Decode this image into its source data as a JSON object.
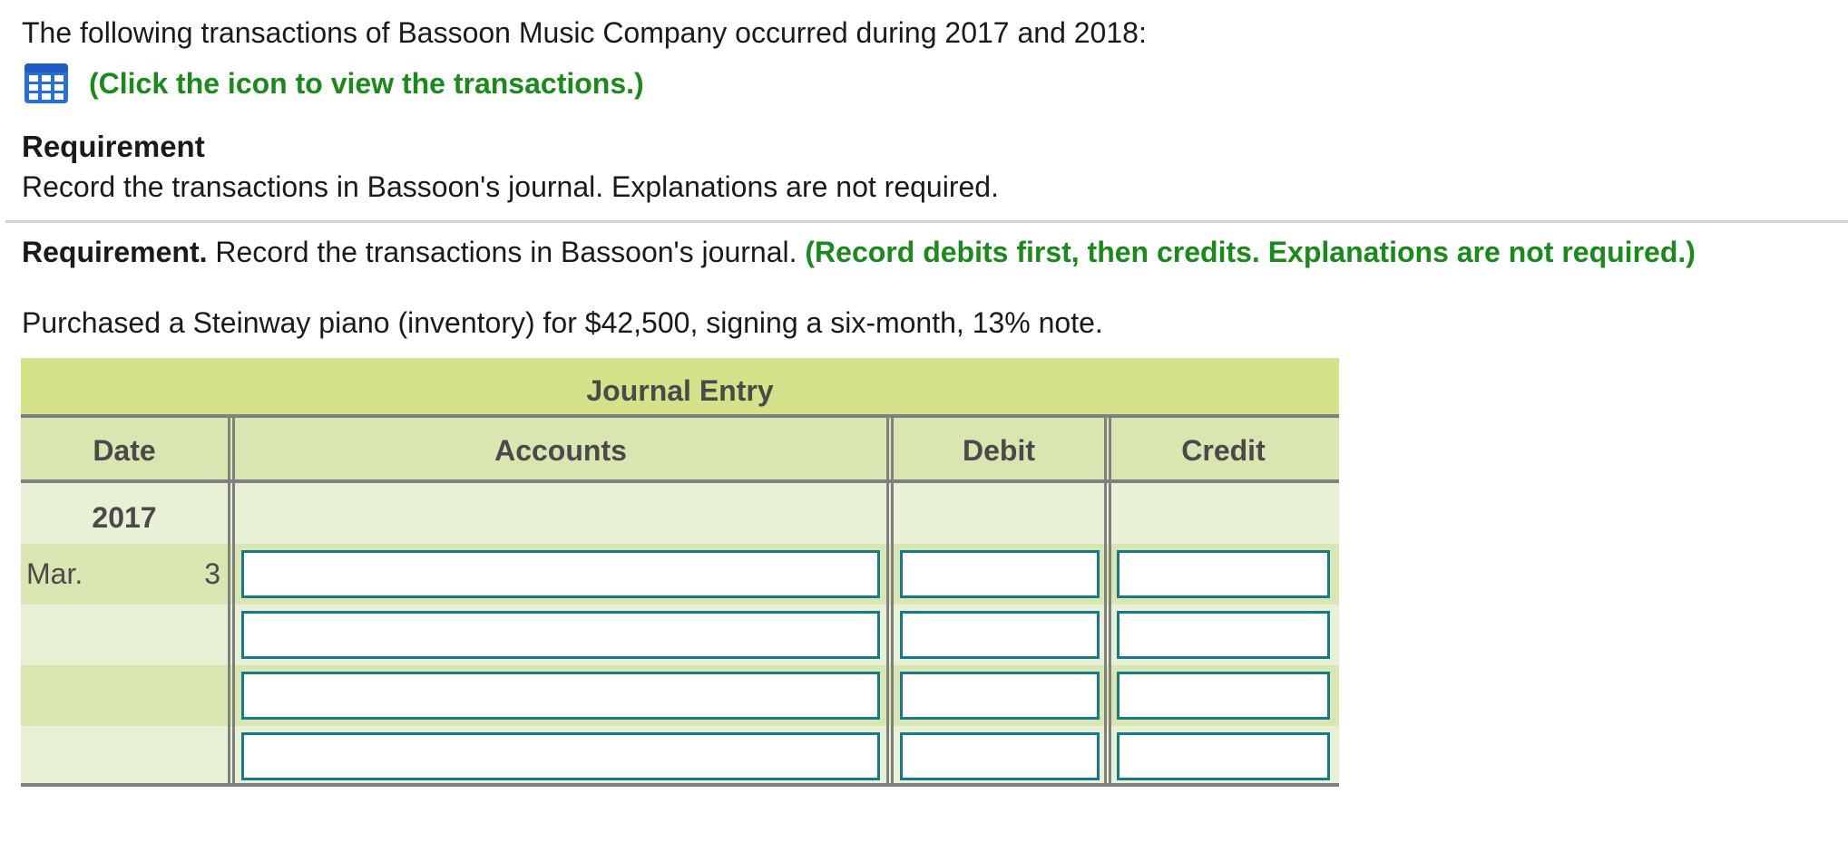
{
  "intro": {
    "text": "The following transactions of Bassoon Music Company occurred during 2017 and 2018:"
  },
  "transactions_link": {
    "icon": "table-icon",
    "label": "(Click the icon to view the transactions.)",
    "color": "#1a8a1a"
  },
  "requirement": {
    "heading": "Requirement",
    "text": "Record the transactions in Bassoon's journal. Explanations are not required."
  },
  "requirement_line": {
    "bold": "Requirement.",
    "text": " Record the transactions in Bassoon's journal. ",
    "note": "(Record debits first, then credits. Explanations are not required.)"
  },
  "transaction": {
    "text": "Purchased a Steinway piano (inventory) for $42,500, signing a six-month, 13% note."
  },
  "journal": {
    "title": "Journal Entry",
    "columns": {
      "date": "Date",
      "accounts": "Accounts",
      "debit": "Debit",
      "credit": "Credit"
    },
    "year": "2017",
    "rows": [
      {
        "month": "Mar.",
        "day": "3",
        "account": "",
        "debit": "",
        "credit": ""
      },
      {
        "month": "",
        "day": "",
        "account": "",
        "debit": "",
        "credit": ""
      },
      {
        "month": "",
        "day": "",
        "account": "",
        "debit": "",
        "credit": ""
      },
      {
        "month": "",
        "day": "",
        "account": "",
        "debit": "",
        "credit": ""
      }
    ]
  },
  "colors": {
    "title_band": "#d6e28a",
    "header_band": "#d9e6b1",
    "light_band": "#e8f0d6",
    "input_border": "#157a8c",
    "green_text": "#1a8a1a"
  }
}
